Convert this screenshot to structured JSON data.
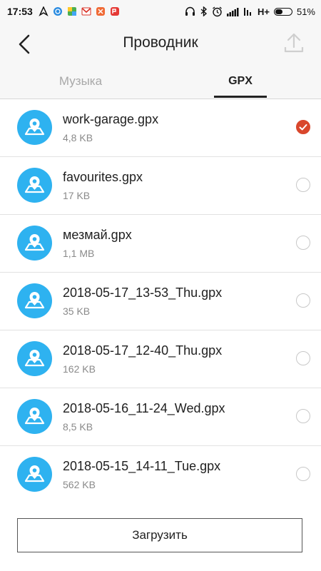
{
  "status_bar": {
    "time": "17:53",
    "network": "H+",
    "battery": "51%",
    "battery_level": 0.51
  },
  "header": {
    "title": "Проводник",
    "back_icon": "chevron-left-icon",
    "upload_icon": "upload-icon"
  },
  "tabs": [
    {
      "label": "Музыка",
      "active": false
    },
    {
      "label": "GPX",
      "active": true
    }
  ],
  "files": [
    {
      "name": "work-garage.gpx",
      "size": "4,8 KB",
      "selected": true
    },
    {
      "name": "favourites.gpx",
      "size": "17 KB",
      "selected": false
    },
    {
      "name": "мезмай.gpx",
      "size": "1,1 MB",
      "selected": false
    },
    {
      "name": "2018-05-17_13-53_Thu.gpx",
      "size": "35 KB",
      "selected": false
    },
    {
      "name": "2018-05-17_12-40_Thu.gpx",
      "size": "162 KB",
      "selected": false
    },
    {
      "name": "2018-05-16_11-24_Wed.gpx",
      "size": "8,5 KB",
      "selected": false
    },
    {
      "name": "2018-05-15_14-11_Tue.gpx",
      "size": "562 KB",
      "selected": false
    }
  ],
  "footer": {
    "upload_button_label": "Загрузить"
  },
  "colors": {
    "accent": "#d9472c",
    "file_icon": "#2eb2f0"
  }
}
